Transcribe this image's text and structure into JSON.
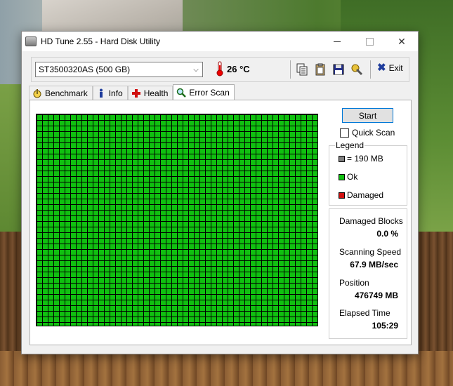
{
  "window": {
    "title": "HD Tune 2.55 - Hard Disk Utility",
    "close_glyph": "✕"
  },
  "toolbar": {
    "drive": "ST3500320AS (500 GB)",
    "temperature": "26 °C",
    "exit_label": "Exit"
  },
  "tabs": [
    {
      "label": "Benchmark",
      "icon": "stopwatch-icon"
    },
    {
      "label": "Info",
      "icon": "info-icon"
    },
    {
      "label": "Health",
      "icon": "health-cross-icon"
    },
    {
      "label": "Error Scan",
      "icon": "magnifier-icon",
      "active": true
    }
  ],
  "scan": {
    "start_label": "Start",
    "quick_scan_label": "Quick Scan",
    "quick_scan_checked": false,
    "block_color": "#10c010"
  },
  "legend": {
    "title": "Legend",
    "items": [
      {
        "label": "= 190 MB",
        "color": "#808080"
      },
      {
        "label": "Ok",
        "color": "#10c010"
      },
      {
        "label": "Damaged",
        "color": "#d01010"
      }
    ]
  },
  "stats": {
    "damaged_blocks_label": "Damaged Blocks",
    "damaged_blocks_value": "0.0 %",
    "scanning_speed_label": "Scanning Speed",
    "scanning_speed_value": "67.9 MB/sec",
    "position_label": "Position",
    "position_value": "476749 MB",
    "elapsed_label": "Elapsed Time",
    "elapsed_value": "105:29"
  }
}
